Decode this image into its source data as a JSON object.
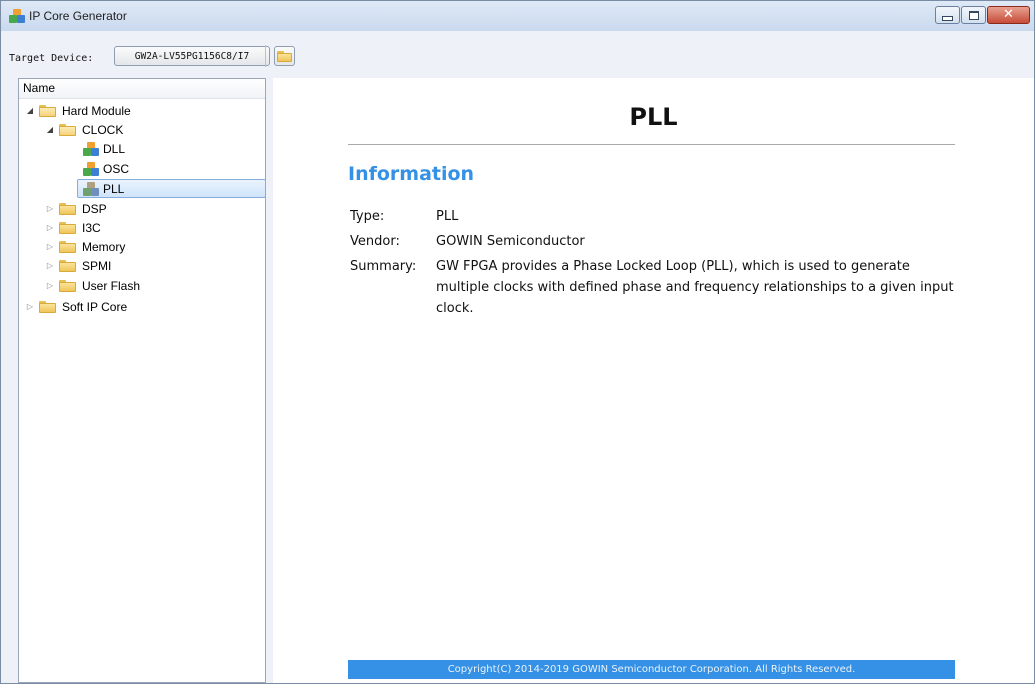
{
  "window": {
    "title": "IP Core Generator"
  },
  "toolbar": {
    "target_device_label": "Target Device:",
    "target_device_value": "GW2A-LV55PG1156C8/I7"
  },
  "tree": {
    "header": "Name",
    "items": [
      {
        "label": "Hard Module",
        "expanded": true,
        "icon": "folder-open-icon"
      },
      {
        "label": "CLOCK",
        "expanded": true,
        "icon": "folder-open-icon"
      },
      {
        "label": "DLL",
        "icon": "ip-core-icon"
      },
      {
        "label": "OSC",
        "icon": "ip-core-icon"
      },
      {
        "label": "PLL",
        "icon": "ip-core-icon",
        "selected": true
      },
      {
        "label": "DSP",
        "expanded": false,
        "icon": "folder-icon"
      },
      {
        "label": "I3C",
        "expanded": false,
        "icon": "folder-icon"
      },
      {
        "label": "Memory",
        "expanded": false,
        "icon": "folder-icon"
      },
      {
        "label": "SPMI",
        "expanded": false,
        "icon": "folder-icon"
      },
      {
        "label": "User Flash",
        "expanded": false,
        "icon": "folder-icon"
      },
      {
        "label": "Soft IP Core",
        "expanded": false,
        "icon": "folder-icon"
      }
    ]
  },
  "content": {
    "title": "PLL",
    "section_title": "Information",
    "info": [
      {
        "key": "Type:",
        "value": "PLL"
      },
      {
        "key": "Vendor:",
        "value": "GOWIN Semiconductor"
      },
      {
        "key": "Summary:",
        "value": "GW FPGA provides a Phase Locked Loop (PLL), which is used to generate multiple clocks with defined phase and frequency relationships to a given input clock."
      }
    ],
    "footer": "Copyright(C) 2014-2019 GOWIN Semiconductor Corporation. All Rights Reserved."
  },
  "colors": {
    "accent": "#3591e5",
    "selection": "#cfe4fb",
    "close_button": "#c74c36"
  }
}
